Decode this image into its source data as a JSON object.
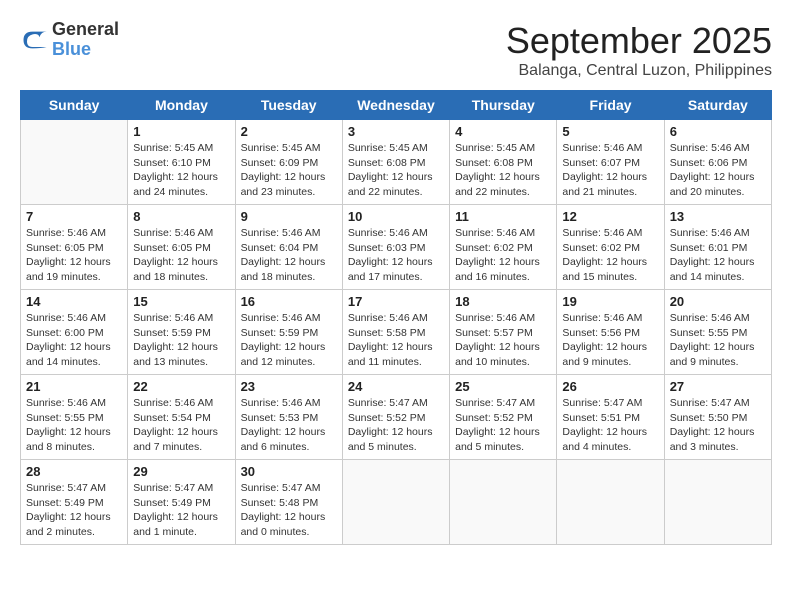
{
  "header": {
    "logo_line1": "General",
    "logo_line2": "Blue",
    "month": "September 2025",
    "location": "Balanga, Central Luzon, Philippines"
  },
  "weekdays": [
    "Sunday",
    "Monday",
    "Tuesday",
    "Wednesday",
    "Thursday",
    "Friday",
    "Saturday"
  ],
  "weeks": [
    [
      {
        "day": "",
        "info": ""
      },
      {
        "day": "1",
        "info": "Sunrise: 5:45 AM\nSunset: 6:10 PM\nDaylight: 12 hours\nand 24 minutes."
      },
      {
        "day": "2",
        "info": "Sunrise: 5:45 AM\nSunset: 6:09 PM\nDaylight: 12 hours\nand 23 minutes."
      },
      {
        "day": "3",
        "info": "Sunrise: 5:45 AM\nSunset: 6:08 PM\nDaylight: 12 hours\nand 22 minutes."
      },
      {
        "day": "4",
        "info": "Sunrise: 5:45 AM\nSunset: 6:08 PM\nDaylight: 12 hours\nand 22 minutes."
      },
      {
        "day": "5",
        "info": "Sunrise: 5:46 AM\nSunset: 6:07 PM\nDaylight: 12 hours\nand 21 minutes."
      },
      {
        "day": "6",
        "info": "Sunrise: 5:46 AM\nSunset: 6:06 PM\nDaylight: 12 hours\nand 20 minutes."
      }
    ],
    [
      {
        "day": "7",
        "info": "Sunrise: 5:46 AM\nSunset: 6:05 PM\nDaylight: 12 hours\nand 19 minutes."
      },
      {
        "day": "8",
        "info": "Sunrise: 5:46 AM\nSunset: 6:05 PM\nDaylight: 12 hours\nand 18 minutes."
      },
      {
        "day": "9",
        "info": "Sunrise: 5:46 AM\nSunset: 6:04 PM\nDaylight: 12 hours\nand 18 minutes."
      },
      {
        "day": "10",
        "info": "Sunrise: 5:46 AM\nSunset: 6:03 PM\nDaylight: 12 hours\nand 17 minutes."
      },
      {
        "day": "11",
        "info": "Sunrise: 5:46 AM\nSunset: 6:02 PM\nDaylight: 12 hours\nand 16 minutes."
      },
      {
        "day": "12",
        "info": "Sunrise: 5:46 AM\nSunset: 6:02 PM\nDaylight: 12 hours\nand 15 minutes."
      },
      {
        "day": "13",
        "info": "Sunrise: 5:46 AM\nSunset: 6:01 PM\nDaylight: 12 hours\nand 14 minutes."
      }
    ],
    [
      {
        "day": "14",
        "info": "Sunrise: 5:46 AM\nSunset: 6:00 PM\nDaylight: 12 hours\nand 14 minutes."
      },
      {
        "day": "15",
        "info": "Sunrise: 5:46 AM\nSunset: 5:59 PM\nDaylight: 12 hours\nand 13 minutes."
      },
      {
        "day": "16",
        "info": "Sunrise: 5:46 AM\nSunset: 5:59 PM\nDaylight: 12 hours\nand 12 minutes."
      },
      {
        "day": "17",
        "info": "Sunrise: 5:46 AM\nSunset: 5:58 PM\nDaylight: 12 hours\nand 11 minutes."
      },
      {
        "day": "18",
        "info": "Sunrise: 5:46 AM\nSunset: 5:57 PM\nDaylight: 12 hours\nand 10 minutes."
      },
      {
        "day": "19",
        "info": "Sunrise: 5:46 AM\nSunset: 5:56 PM\nDaylight: 12 hours\nand 9 minutes."
      },
      {
        "day": "20",
        "info": "Sunrise: 5:46 AM\nSunset: 5:55 PM\nDaylight: 12 hours\nand 9 minutes."
      }
    ],
    [
      {
        "day": "21",
        "info": "Sunrise: 5:46 AM\nSunset: 5:55 PM\nDaylight: 12 hours\nand 8 minutes."
      },
      {
        "day": "22",
        "info": "Sunrise: 5:46 AM\nSunset: 5:54 PM\nDaylight: 12 hours\nand 7 minutes."
      },
      {
        "day": "23",
        "info": "Sunrise: 5:46 AM\nSunset: 5:53 PM\nDaylight: 12 hours\nand 6 minutes."
      },
      {
        "day": "24",
        "info": "Sunrise: 5:47 AM\nSunset: 5:52 PM\nDaylight: 12 hours\nand 5 minutes."
      },
      {
        "day": "25",
        "info": "Sunrise: 5:47 AM\nSunset: 5:52 PM\nDaylight: 12 hours\nand 5 minutes."
      },
      {
        "day": "26",
        "info": "Sunrise: 5:47 AM\nSunset: 5:51 PM\nDaylight: 12 hours\nand 4 minutes."
      },
      {
        "day": "27",
        "info": "Sunrise: 5:47 AM\nSunset: 5:50 PM\nDaylight: 12 hours\nand 3 minutes."
      }
    ],
    [
      {
        "day": "28",
        "info": "Sunrise: 5:47 AM\nSunset: 5:49 PM\nDaylight: 12 hours\nand 2 minutes."
      },
      {
        "day": "29",
        "info": "Sunrise: 5:47 AM\nSunset: 5:49 PM\nDaylight: 12 hours\nand 1 minute."
      },
      {
        "day": "30",
        "info": "Sunrise: 5:47 AM\nSunset: 5:48 PM\nDaylight: 12 hours\nand 0 minutes."
      },
      {
        "day": "",
        "info": ""
      },
      {
        "day": "",
        "info": ""
      },
      {
        "day": "",
        "info": ""
      },
      {
        "day": "",
        "info": ""
      }
    ]
  ]
}
